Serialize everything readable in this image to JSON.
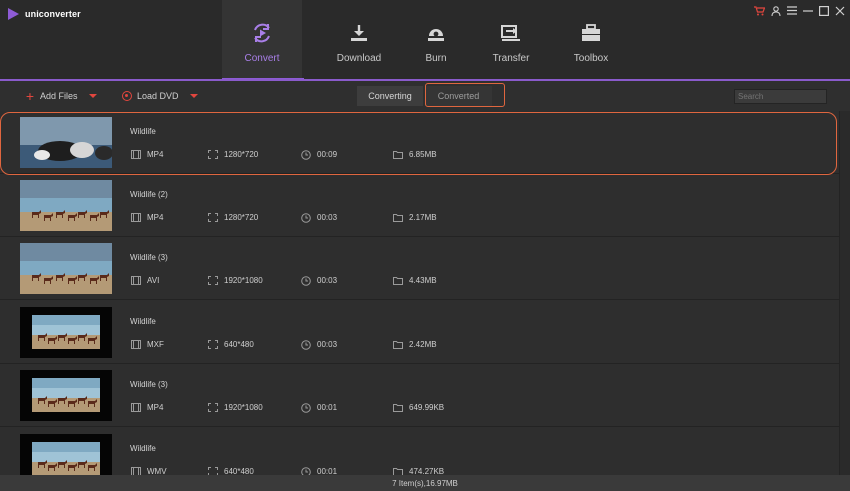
{
  "app": {
    "title": "uniconverter"
  },
  "window_controls": [
    {
      "name": "cart-icon",
      "glyph": "🛒"
    },
    {
      "name": "user-icon",
      "glyph": "♙"
    },
    {
      "name": "menu-icon",
      "glyph": "☰"
    },
    {
      "name": "minimize-icon",
      "glyph": "—"
    },
    {
      "name": "maximize-icon",
      "glyph": "☐"
    },
    {
      "name": "close-icon",
      "glyph": "✕"
    }
  ],
  "nav": {
    "active": "Convert",
    "items": [
      {
        "label": "Convert",
        "icon": "convert-icon"
      },
      {
        "label": "Download",
        "icon": "download-icon"
      },
      {
        "label": "Burn",
        "icon": "burn-icon"
      },
      {
        "label": "Transfer",
        "icon": "transfer-icon"
      },
      {
        "label": "Toolbox",
        "icon": "toolbox-icon"
      }
    ]
  },
  "toolbar": {
    "add_files": "Add Files",
    "load_dvd": "Load DVD",
    "tabs": {
      "converting": "Converting",
      "converted": "Converted"
    },
    "search_placeholder": "Search"
  },
  "files": [
    {
      "name": "Wildlife",
      "format": "MP4",
      "resolution": "1280*720",
      "duration": "00:09",
      "size": "6.85MB",
      "thumb": "rocks"
    },
    {
      "name": "Wildlife (2)",
      "format": "MP4",
      "resolution": "1280*720",
      "duration": "00:03",
      "size": "2.17MB",
      "thumb": "horses-wide"
    },
    {
      "name": "Wildlife (3)",
      "format": "AVI",
      "resolution": "1920*1080",
      "duration": "00:03",
      "size": "4.43MB",
      "thumb": "horses-wide"
    },
    {
      "name": "Wildlife",
      "format": "MXF",
      "resolution": "640*480",
      "duration": "00:03",
      "size": "2.42MB",
      "thumb": "horses-box"
    },
    {
      "name": "Wildlife (3)",
      "format": "MP4",
      "resolution": "1920*1080",
      "duration": "00:01",
      "size": "649.99KB",
      "thumb": "horses-box"
    },
    {
      "name": "Wildlife",
      "format": "WMV",
      "resolution": "640*480",
      "duration": "00:01",
      "size": "474.27KB",
      "thumb": "horses-box"
    }
  ],
  "status": {
    "summary": "7 Item(s),16.97MB"
  },
  "colors": {
    "accent": "#8e5bd6",
    "highlight": "#e0663f",
    "icon_red": "#e2463e"
  }
}
